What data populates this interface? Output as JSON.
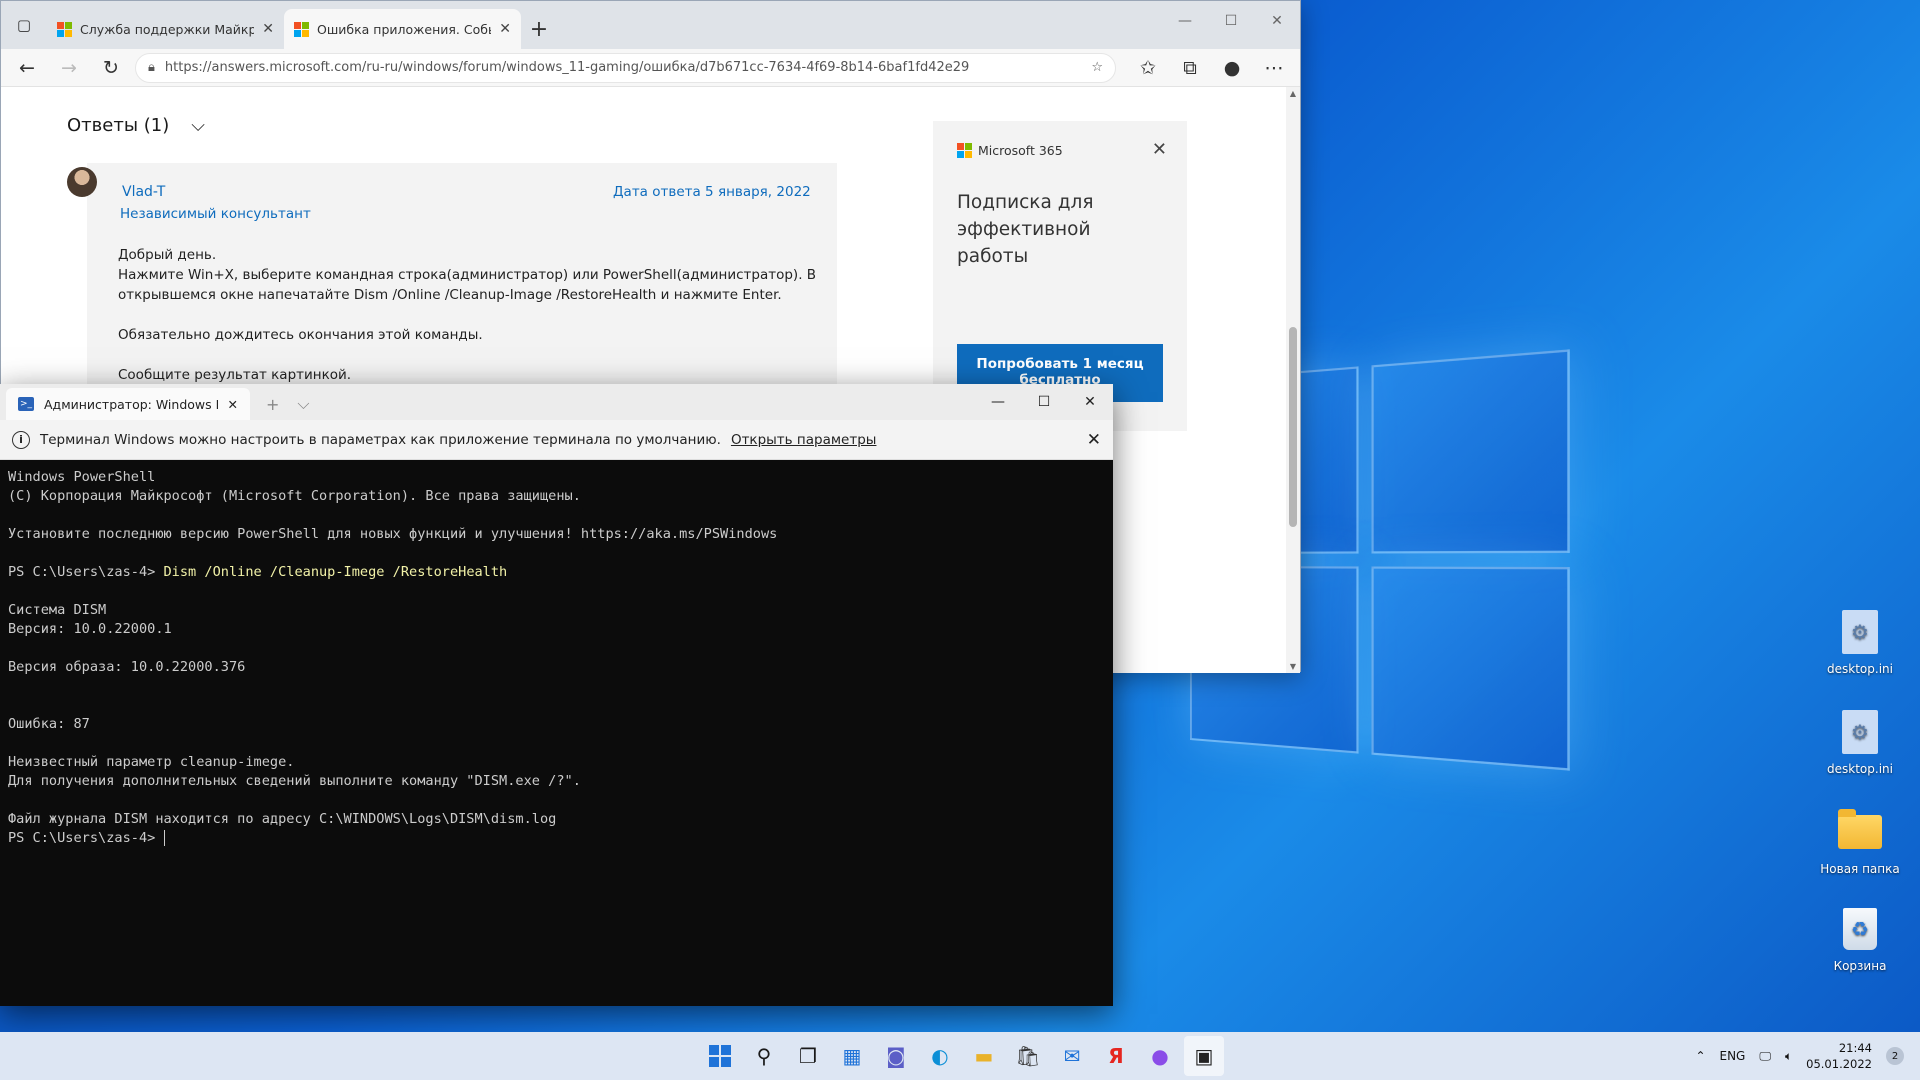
{
  "browser": {
    "tabs": [
      {
        "label": "Служба поддержки Майкрософт"
      },
      {
        "label": "Ошибка приложения. Событие"
      }
    ],
    "url": "https://answers.microsoft.com/ru-ru/windows/forum/windows_11-gaming/ошибка/d7b671cc-7634-4f69-8b14-6baf1fd42e29",
    "page": {
      "answers_heading": "Ответы (1)",
      "author": "Vlad-T",
      "role": "Независимый консультант",
      "date": "Дата ответа 5 января, 2022",
      "body": [
        "Добрый день.",
        "Нажмите Win+X, выберите командная строка(администратор) или PowerShell(администратор). В",
        "открывшемся окне напечатайте Dism /Online /Cleanup-Image /RestoreHealth и нажмите Enter.",
        "",
        "Обязательно дождитесь окончания этой команды.",
        "",
        "Сообщите результат картинкой."
      ],
      "ad": {
        "brand": "Microsoft 365",
        "title": "Подписка для эффективной работы",
        "button": "Попробовать 1 месяц бесплатно"
      }
    }
  },
  "terminal": {
    "tab_label": "Администратор: Windows PowerShell",
    "info_text": "Терминал Windows можно настроить в параметрах как приложение терминала по умолчанию.",
    "info_link": "Открыть параметры",
    "lines": [
      "Windows PowerShell",
      "(C) Корпорация Майкрософт (Microsoft Corporation). Все права защищены.",
      "",
      "Установите последнюю версию PowerShell для новых функций и улучшения! https://aka.ms/PSWindows",
      "",
      "PS C:\\Users\\zas-4> ",
      "",
      "Система DISM",
      "Версия: 10.0.22000.1",
      "",
      "Версия образа: 10.0.22000.376",
      "",
      "",
      "Ошибка: 87",
      "",
      "Неизвестный параметр cleanup-imege.",
      "Для получения дополнительных сведений выполните команду \"DISM.exe /?\".",
      "",
      "Файл журнала DISM находится по адресу C:\\WINDOWS\\Logs\\DISM\\dism.log",
      "PS C:\\Users\\zas-4> "
    ],
    "command": "Dism /Online /Cleanup-Imege /RestoreHealth"
  },
  "desktop": {
    "icons": [
      {
        "label": "desktop.ini"
      },
      {
        "label": "desktop.ini"
      },
      {
        "label": "Новая папка"
      },
      {
        "label": "Корзина"
      }
    ]
  },
  "taskbar": {
    "lang": "ENG",
    "time": "21:44",
    "date": "05.01.2022",
    "notifications": "2"
  },
  "colors": {
    "accent": "#0f6cbd",
    "terminal_bg": "#0c0c0c"
  }
}
